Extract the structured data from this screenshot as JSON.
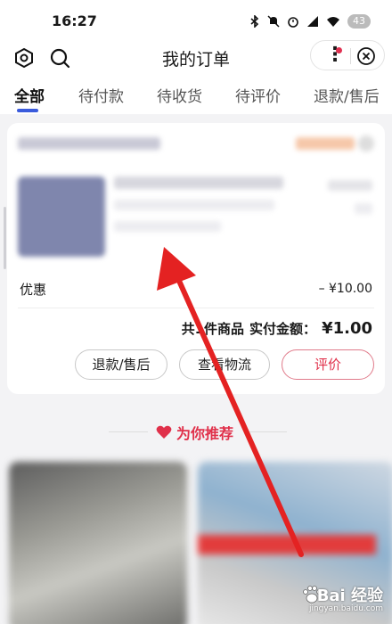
{
  "status_bar": {
    "time": "16:27",
    "battery": "43"
  },
  "header": {
    "title": "我的订单"
  },
  "tabs": [
    {
      "label": "全部",
      "active": true
    },
    {
      "label": "待付款",
      "active": false
    },
    {
      "label": "待收货",
      "active": false
    },
    {
      "label": "待评价",
      "active": false
    },
    {
      "label": "退款/售后",
      "active": false
    }
  ],
  "order": {
    "discount_label": "优惠",
    "discount_value": "– ¥10.00",
    "summary_prefix": "共1件商品",
    "paid_label": "实付金额：",
    "paid_amount": "¥1.00",
    "buttons": {
      "refund": "退款/售后",
      "track": "查看物流",
      "review": "评价"
    }
  },
  "recommend": {
    "label": "为你推荐"
  },
  "watermark": {
    "brand": "Bai 经验",
    "url": "jingyan.baidu.com"
  },
  "colors": {
    "accent": "#3a5bdc",
    "red": "#e0304a",
    "annotation_arrow": "#e42222"
  }
}
